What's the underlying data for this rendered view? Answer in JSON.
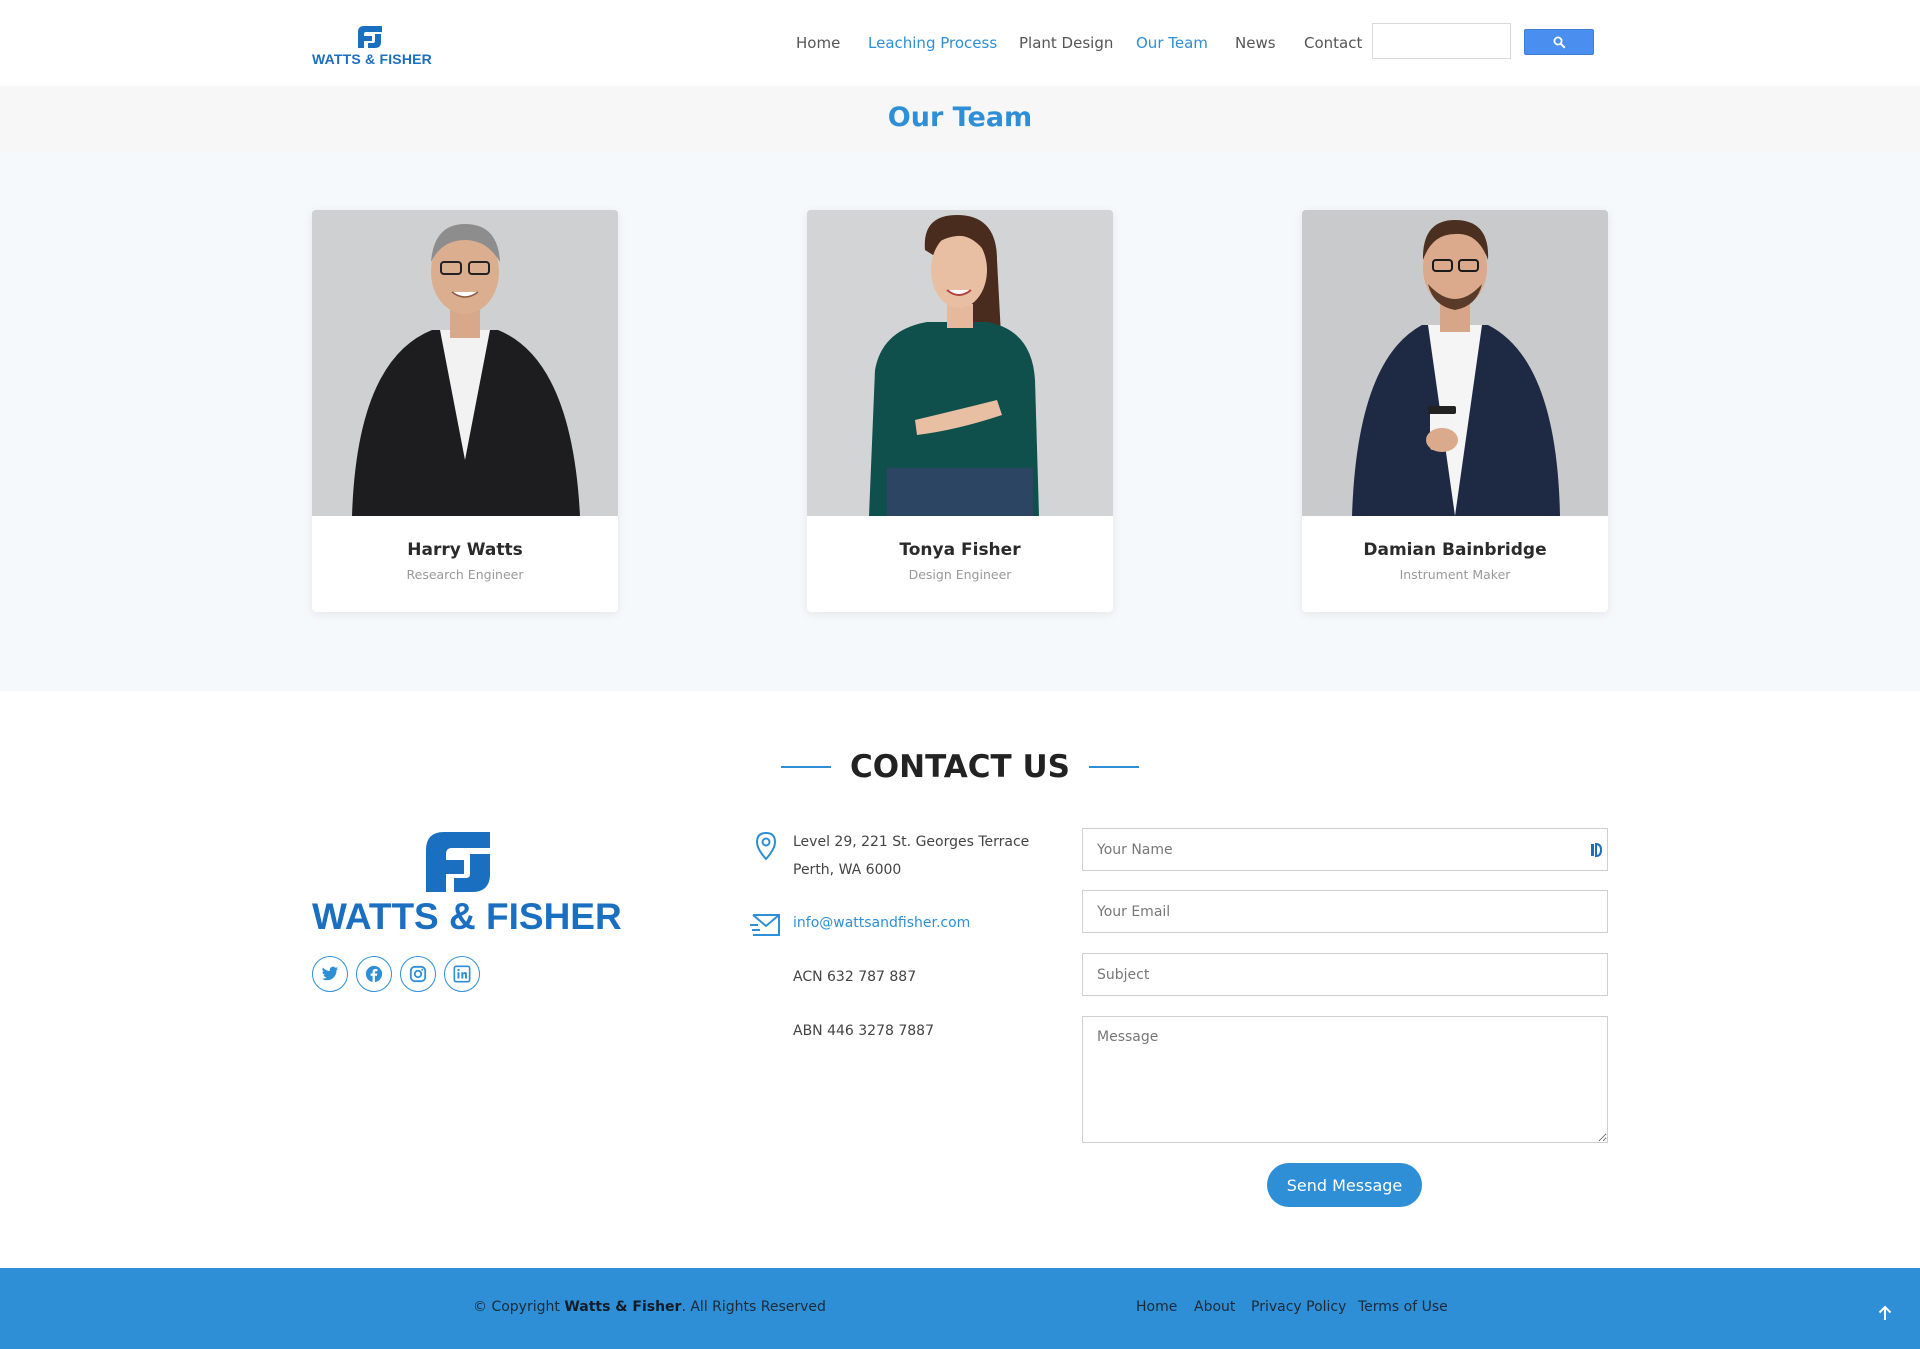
{
  "header": {
    "logo_text": "WATTS & FISHER",
    "nav": [
      {
        "label": "Home",
        "active": false
      },
      {
        "label": "Leaching Process",
        "active": true
      },
      {
        "label": "Plant Design",
        "active": false
      },
      {
        "label": "Our Team",
        "active": true
      },
      {
        "label": "News",
        "active": false
      },
      {
        "label": "Contact",
        "active": false
      }
    ],
    "search": {
      "value": "",
      "button_icon": "search-icon"
    }
  },
  "page_title": "Our Team",
  "team": [
    {
      "name": "Harry Watts",
      "role": "Research Engineer"
    },
    {
      "name": "Tonya Fisher",
      "role": "Design Engineer"
    },
    {
      "name": "Damian Bainbridge",
      "role": "Instrument Maker"
    }
  ],
  "contact": {
    "heading": "CONTACT US",
    "logo_text": "WATTS & FISHER",
    "social": [
      "twitter-icon",
      "facebook-icon",
      "instagram-icon",
      "linkedin-icon"
    ],
    "address_line1": "Level 29, 221 St. Georges Terrace",
    "address_line2": "Perth, WA 6000",
    "email": "info@wattsandfisher.com",
    "acn": "ACN 632 787 887",
    "abn": "ABN 446 3278 7887",
    "form": {
      "name_placeholder": "Your Name",
      "email_placeholder": "Your Email",
      "subject_placeholder": "Subject",
      "message_placeholder": "Message",
      "submit_label": "Send Message"
    }
  },
  "footer": {
    "copyright_prefix": "© Copyright ",
    "copyright_brand": "Watts & Fisher",
    "copyright_suffix": ". All Rights Reserved",
    "links": [
      "Home",
      "About",
      "Privacy Policy",
      "Terms of Use"
    ],
    "to_top_icon": "arrow-up-icon"
  },
  "colors": {
    "accent": "#2e8fd6",
    "brand": "#1b6fc0",
    "footer_bg": "#2e8fd6",
    "search_button": "#4a8ff0"
  }
}
